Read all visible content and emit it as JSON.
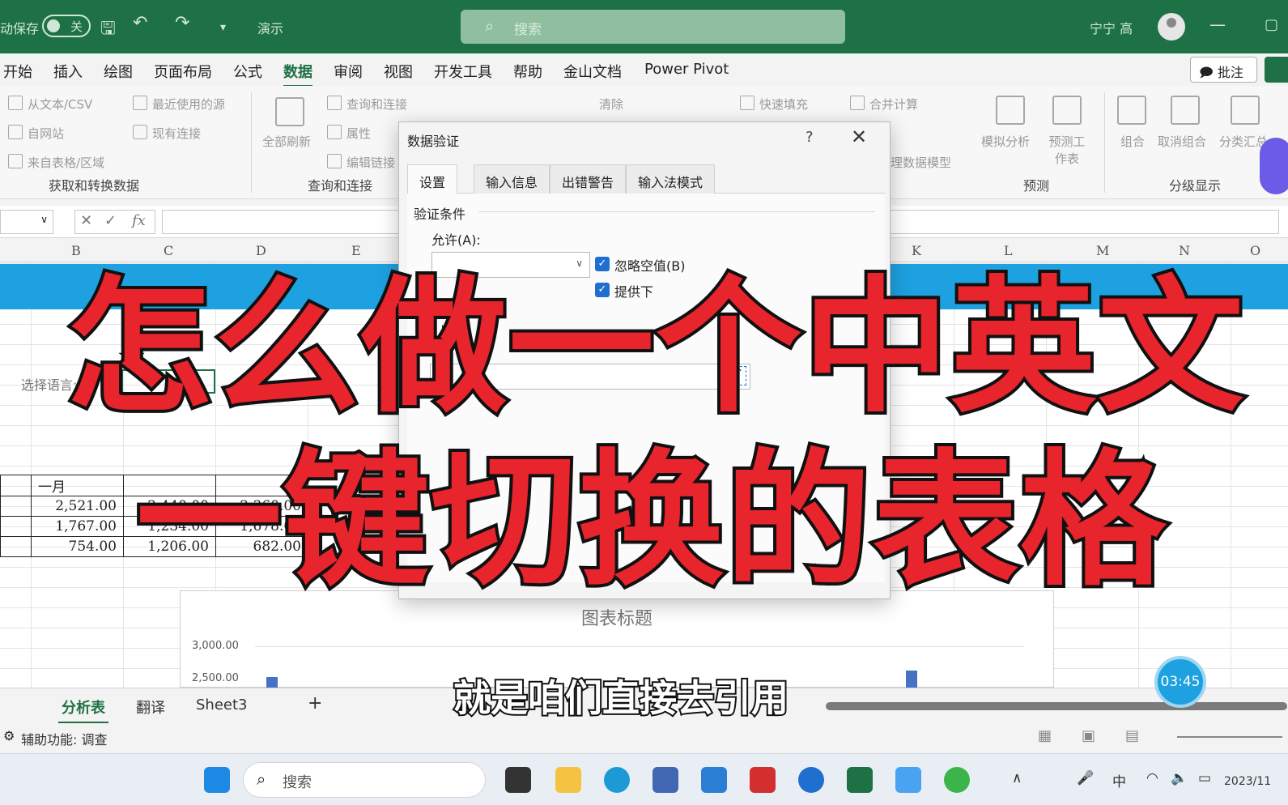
{
  "titlebar": {
    "autosave_label": "动保存",
    "autosave_state": "关",
    "present_label": "演示",
    "search_placeholder": "搜索",
    "user_name": "宁宁 高"
  },
  "menu": {
    "tabs": [
      "开始",
      "插入",
      "绘图",
      "页面布局",
      "公式",
      "数据",
      "审阅",
      "视图",
      "开发工具",
      "帮助",
      "金山文档",
      "Power Pivot"
    ],
    "active": "数据",
    "comments_label": "批注"
  },
  "ribbon": {
    "get_data": [
      "从文本/CSV",
      "自网站",
      "来自表格/区域",
      "最近使用的源",
      "现有连接"
    ],
    "get_data_group": "获取和转换数据",
    "refresh_all": "全部刷新",
    "queries": [
      "查询和连接",
      "属性",
      "编辑链接"
    ],
    "queries_group": "查询和连接",
    "clear": "清除",
    "flash_fill": "快速填充",
    "consolidate": "合并计算",
    "data_model": "理数据模型",
    "what_if": "模拟分析",
    "forecast_sheet": "预测工作表",
    "forecast_group": "预测",
    "group": "组合",
    "ungroup": "取消组合",
    "subtotal": "分类汇总",
    "outline_group": "分级显示"
  },
  "formula_bar": {
    "fx": "fx",
    "value": ""
  },
  "columns": [
    "B",
    "C",
    "D",
    "E",
    "K",
    "L",
    "M",
    "N",
    "O"
  ],
  "sheet": {
    "language_label": "选择语言:",
    "header_row": [
      "一月"
    ],
    "rows": [
      [
        "2,521.00",
        "2,440.00",
        "2,360.00"
      ],
      [
        "1,767.00",
        "1,234.00",
        "1,678.00"
      ],
      [
        "754.00",
        "1,206.00",
        "682.00"
      ]
    ]
  },
  "chart_data": {
    "type": "bar",
    "title": "图表标题",
    "y_ticks": [
      "3,000.00",
      "2,500.00"
    ],
    "ylim": [
      2500,
      3000
    ]
  },
  "sheet_tabs": [
    "分析表",
    "翻译",
    "Sheet3"
  ],
  "active_sheet": "分析表",
  "add_sheet": "+",
  "status": {
    "accessibility": "辅助功能: 调查"
  },
  "dialog": {
    "title": "数据验证",
    "help": "?",
    "close": "✕",
    "tabs": [
      "设置",
      "输入信息",
      "出错警告",
      "输入法模式"
    ],
    "active_tab": "设置",
    "criteria_label": "验证条件",
    "allow_label": "允许(A):",
    "ignore_blank": "忽略空值(B)",
    "provide_dropdown": "提供下"
  },
  "overlay": {
    "line1": "怎么做一个中英文",
    "line2": "一键切换的表格",
    "subtitle": "就是咱们直接去引用",
    "timer": "03:45"
  },
  "taskbar": {
    "search": "搜索",
    "ime": "中",
    "date": "2023/11"
  }
}
